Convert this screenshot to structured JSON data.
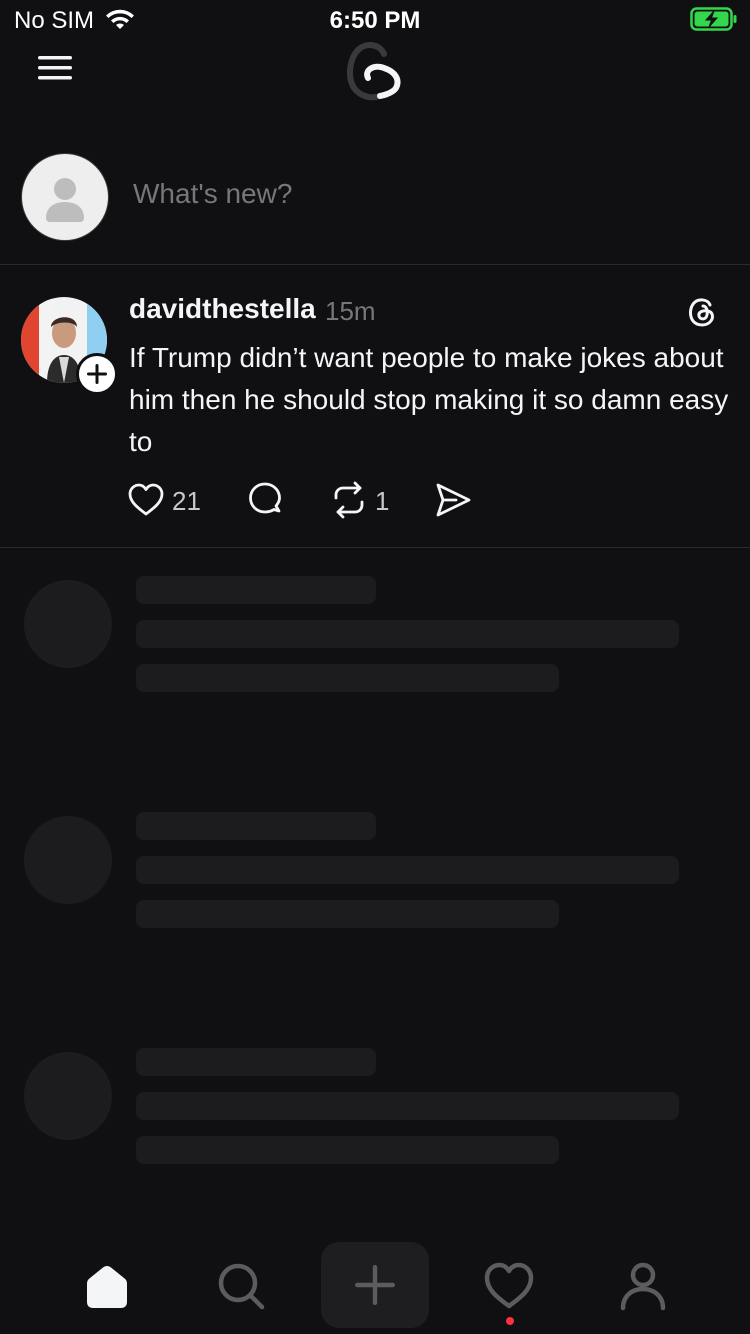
{
  "status_bar": {
    "carrier": "No SIM",
    "time": "6:50 PM",
    "wifi_icon": "wifi-icon",
    "battery_icon": "battery-charging-icon",
    "battery_color": "#32d74b"
  },
  "header": {
    "menu_icon": "menu-icon",
    "logo_icon": "threads-logo-icon"
  },
  "composer": {
    "placeholder": "What's new?",
    "avatar_icon": "default-avatar-icon"
  },
  "post": {
    "username": "davidthestella",
    "time": "15m",
    "text": "If Trump didn’t want people to make jokes about him then he should stop making it so damn easy to",
    "likes": "21",
    "reposts": "1",
    "icons": {
      "threads": "threads-logo-icon",
      "like": "heart-icon",
      "reply": "comment-icon",
      "repost": "repost-icon",
      "share": "send-icon",
      "follow": "plus-icon"
    }
  },
  "skeleton_count": 3,
  "bottom_nav": {
    "items": [
      {
        "name": "home",
        "icon": "home-icon",
        "active": true
      },
      {
        "name": "search",
        "icon": "search-icon",
        "active": false
      },
      {
        "name": "create",
        "icon": "plus-icon",
        "active": false
      },
      {
        "name": "activity",
        "icon": "heart-icon",
        "active": false
      },
      {
        "name": "profile",
        "icon": "person-icon",
        "active": false
      }
    ],
    "notification_dot_color": "#ff3040"
  },
  "colors": {
    "background": "#101012",
    "text_primary": "#f3f5f7",
    "text_secondary": "#77777b",
    "skeleton": "#1c1c1e"
  }
}
